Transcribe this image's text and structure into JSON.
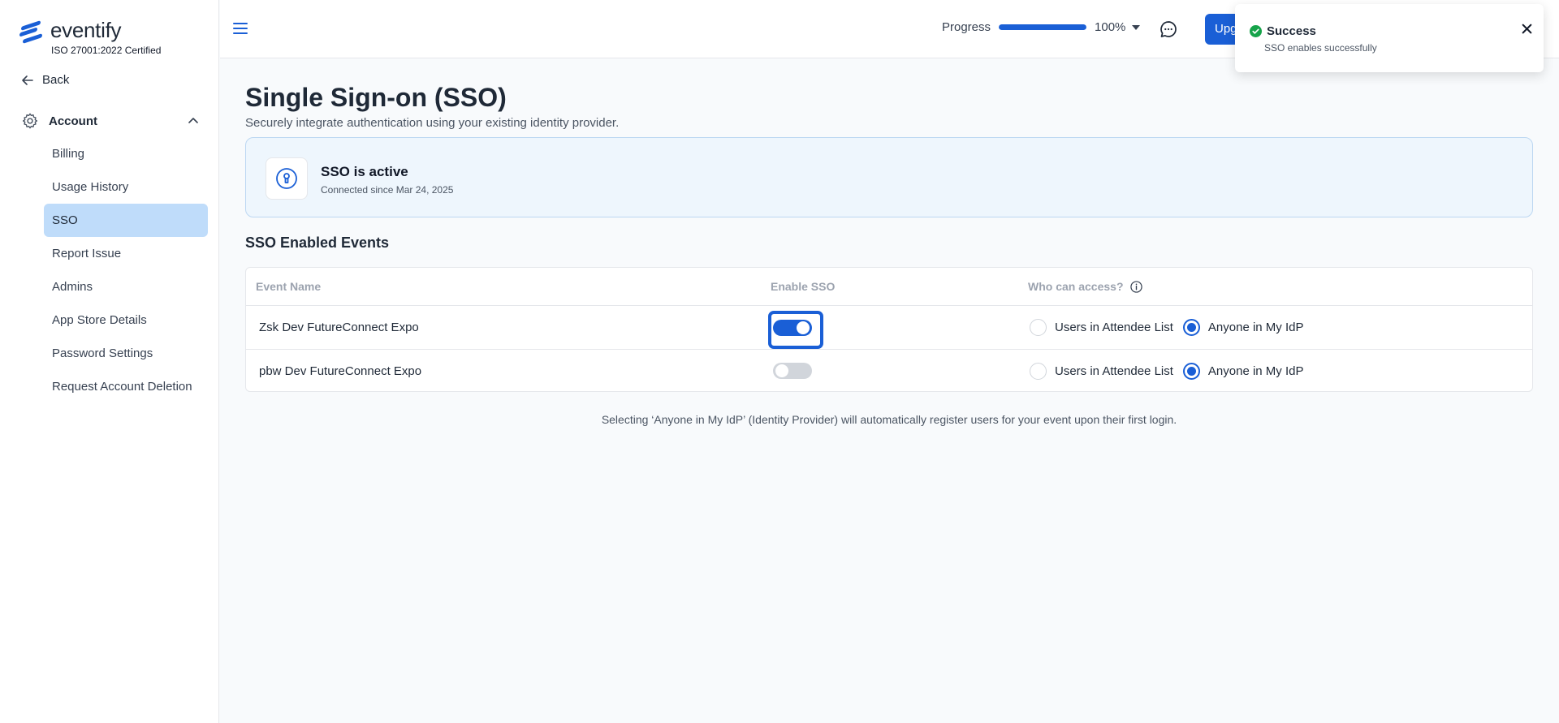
{
  "brand": {
    "name": "eventify",
    "certification": "ISO 27001:2022 Certified",
    "accent_color": "#1a5fd6"
  },
  "sidebar": {
    "back_label": "Back",
    "section": {
      "label": "Account",
      "icon": "gear-icon",
      "expanded": true
    },
    "items": [
      {
        "label": "Billing",
        "active": false
      },
      {
        "label": "Usage History",
        "active": false
      },
      {
        "label": "SSO",
        "active": true
      },
      {
        "label": "Report Issue",
        "active": false
      },
      {
        "label": "Admins",
        "active": false
      },
      {
        "label": "App Store Details",
        "active": false
      },
      {
        "label": "Password Settings",
        "active": false
      },
      {
        "label": "Request Account Deletion",
        "active": false
      }
    ]
  },
  "header": {
    "progress_label": "Progress",
    "progress_value": "100%",
    "progress_fraction": 1.0,
    "upgrade_label": "Upgrade"
  },
  "toast": {
    "title": "Success",
    "message": "SSO enables successfully",
    "status_color": "#16a34a"
  },
  "main": {
    "title": "Single Sign-on (SSO)",
    "subtitle": "Securely integrate authentication using your existing identity provider.",
    "status_card": {
      "title": "SSO is active",
      "subtitle": "Connected since Mar 24, 2025"
    },
    "events_section_title": "SSO Enabled Events",
    "table": {
      "columns": [
        "Event Name",
        "Enable SSO",
        "Who can access?"
      ],
      "radio_labels": [
        "Users in Attendee List",
        "Anyone in My IdP"
      ],
      "rows": [
        {
          "name": "Zsk Dev FutureConnect Expo",
          "sso_enabled": true,
          "access": "Anyone in My IdP"
        },
        {
          "name": "pbw Dev FutureConnect Expo",
          "sso_enabled": false,
          "access": "Anyone in My IdP"
        }
      ]
    },
    "footnote": "Selecting ‘Anyone in My IdP’ (Identity Provider) will automatically register users for your event upon their first login."
  }
}
